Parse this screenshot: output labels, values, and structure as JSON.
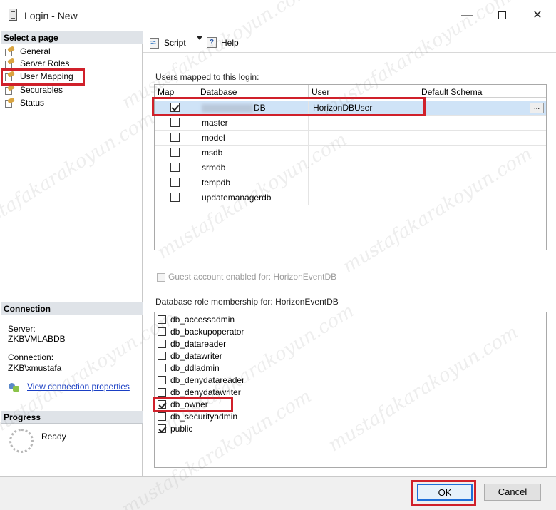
{
  "window": {
    "title": "Login - New",
    "minimize": "—",
    "close": "✕"
  },
  "left": {
    "select_page_header": "Select a page",
    "pages": [
      {
        "label": "General",
        "icon": "wrench-page-icon"
      },
      {
        "label": "Server Roles",
        "icon": "wrench-page-icon"
      },
      {
        "label": "User Mapping",
        "icon": "wrench-page-icon"
      },
      {
        "label": "Securables",
        "icon": "wrench-page-icon"
      },
      {
        "label": "Status",
        "icon": "wrench-page-icon"
      }
    ],
    "connection_header": "Connection",
    "server_label": "Server:",
    "server_value": "ZKBVMLABDB",
    "connection_label": "Connection:",
    "connection_value": "ZKB\\xmustafa",
    "view_connection_link": "View connection properties",
    "progress_header": "Progress",
    "progress_status": "Ready"
  },
  "toolbar": {
    "script_label": "Script",
    "help_label": "Help"
  },
  "mapping": {
    "group_label": "Users mapped to this login:",
    "columns": [
      "Map",
      "Database",
      "User",
      "Default Schema"
    ],
    "rows": [
      {
        "checked": true,
        "database": "DB",
        "user": "HorizonDBUser",
        "schema": ""
      },
      {
        "checked": false,
        "database": "master",
        "user": "",
        "schema": ""
      },
      {
        "checked": false,
        "database": "model",
        "user": "",
        "schema": ""
      },
      {
        "checked": false,
        "database": "msdb",
        "user": "",
        "schema": ""
      },
      {
        "checked": false,
        "database": "srmdb",
        "user": "",
        "schema": ""
      },
      {
        "checked": false,
        "database": "tempdb",
        "user": "",
        "schema": ""
      },
      {
        "checked": false,
        "database": "updatemanagerdb",
        "user": "",
        "schema": ""
      }
    ],
    "ellipsis": "..."
  },
  "guest": {
    "label": "Guest account enabled for: HorizonEventDB",
    "checked": false
  },
  "roles": {
    "group_label": "Database role membership for: HorizonEventDB",
    "items": [
      {
        "label": "db_accessadmin",
        "checked": false
      },
      {
        "label": "db_backupoperator",
        "checked": false
      },
      {
        "label": "db_datareader",
        "checked": false
      },
      {
        "label": "db_datawriter",
        "checked": false
      },
      {
        "label": "db_ddladmin",
        "checked": false
      },
      {
        "label": "db_denydatareader",
        "checked": false
      },
      {
        "label": "db_denydatawriter",
        "checked": false
      },
      {
        "label": "db_owner",
        "checked": true
      },
      {
        "label": "db_securityadmin",
        "checked": false
      },
      {
        "label": "public",
        "checked": true
      }
    ]
  },
  "footer": {
    "ok_label": "OK",
    "cancel_label": "Cancel"
  },
  "watermark": "mustafakarakoyun.com",
  "colors": {
    "annotation_red": "#d0202a",
    "selection_blue": "#cfe3f7",
    "link_blue": "#1a3fc4"
  }
}
